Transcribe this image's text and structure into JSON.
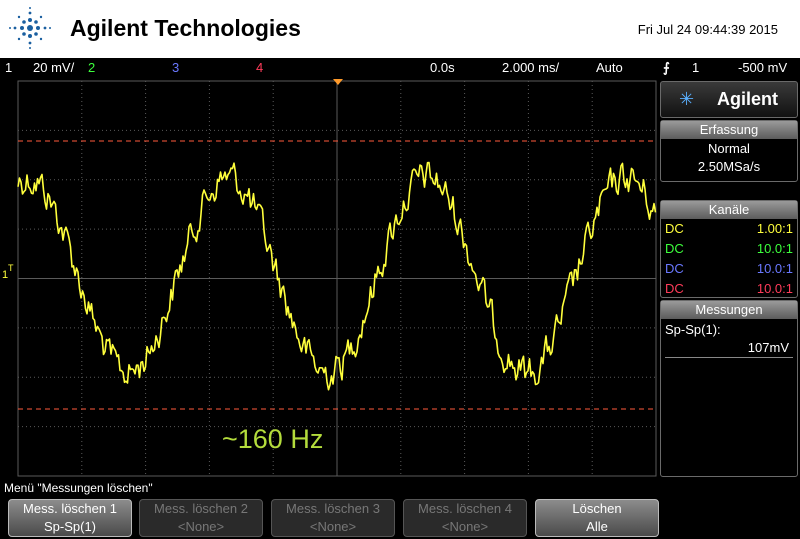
{
  "header": {
    "brand": "Agilent Technologies",
    "datetime": "Fri Jul 24 09:44:39 2015"
  },
  "status": {
    "ch1_num": "1",
    "ch1_scale": "20 mV/",
    "ch2": "2",
    "ch3": "3",
    "ch4": "4",
    "time_offset": "0.0s",
    "time_scale": "2.000 ms/",
    "trigger_mode": "Auto",
    "trigger_src": "1",
    "trigger_level": "-500 mV"
  },
  "colors": {
    "ch1": "#ffff3c",
    "ch2": "#3cff3c",
    "ch3": "#6a78ff",
    "ch4": "#ff3c5a",
    "grid": "#5a5a5a",
    "cursor": "#ff5a3c",
    "annotation": "#b4dc3c"
  },
  "screen": {
    "annotation": "~160 Hz",
    "ch1_marker": "1",
    "trigger_marker": "T"
  },
  "side": {
    "brand": "Agilent",
    "acq_title": "Erfassung",
    "acq_mode": "Normal",
    "acq_rate": "2.50MSa/s",
    "ch_title": "Kanäle",
    "channels": [
      {
        "coupling": "DC",
        "ratio": "1.00:1"
      },
      {
        "coupling": "DC",
        "ratio": "10.0:1"
      },
      {
        "coupling": "DC",
        "ratio": "10.0:1"
      },
      {
        "coupling": "DC",
        "ratio": "10.0:1"
      }
    ],
    "meas_title": "Messungen",
    "meas_name": "Sp-Sp(1):",
    "meas_value": "107mV"
  },
  "menu": {
    "title": "Menü \"Messungen löschen\"",
    "softkeys": [
      {
        "line1": "Mess. löschen 1",
        "line2": "Sp-Sp(1)",
        "active": true
      },
      {
        "line1": "Mess. löschen 2",
        "line2": "<None>",
        "active": false
      },
      {
        "line1": "Mess. löschen 3",
        "line2": "<None>",
        "active": false
      },
      {
        "line1": "Mess. löschen 4",
        "line2": "<None>",
        "active": false
      },
      {
        "line1": "Löschen",
        "line2": "Alle",
        "active": true
      }
    ]
  },
  "waveform": {
    "channel": "1",
    "frequency_hz": 160,
    "peak_to_peak_mv": 107
  }
}
